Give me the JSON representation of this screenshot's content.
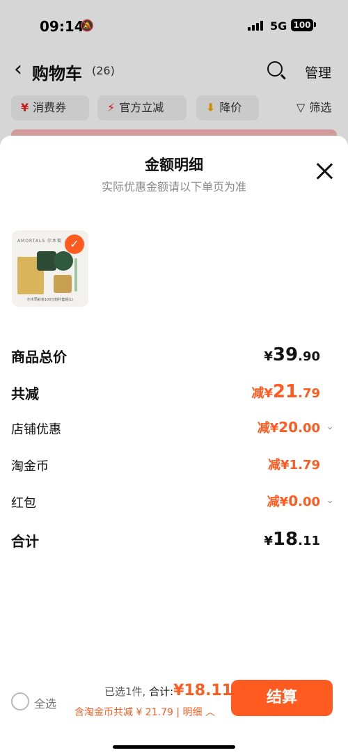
{
  "status_bar": {
    "time": "09:14",
    "network": "5G",
    "battery": "100"
  },
  "header": {
    "title": "购物车",
    "count": "(26)",
    "manage_label": "管理"
  },
  "filters": [
    {
      "icon": "¥",
      "label": "消费券"
    },
    {
      "icon": "⚡",
      "label": "官方立减"
    },
    {
      "icon": "⬇",
      "label": "降价"
    },
    {
      "icon": "▽",
      "label": "筛选"
    }
  ],
  "sheet": {
    "title": "金额明细",
    "subtitle": "实际优惠金额请以下单页为准",
    "product": {
      "brand": "AMORTALS 尔木萄",
      "caption": "尔木萄彩妆100分粉扑套组(L)"
    },
    "rows": [
      {
        "label": "商品总价",
        "prefix": "¥",
        "int": "39",
        "dec": ".90"
      },
      {
        "label": "共减",
        "prefix": "减¥",
        "int": "21",
        "dec": ".79"
      },
      {
        "label": "店铺优惠",
        "prefix": "减¥",
        "int": "20",
        "dec": ".00"
      },
      {
        "label": "淘金币",
        "prefix": "减¥",
        "int": "1",
        "dec": ".79"
      },
      {
        "label": "红包",
        "prefix": "减¥",
        "int": "0",
        "dec": ".00"
      },
      {
        "label": "合计",
        "prefix": "¥",
        "int": "18",
        "dec": ".11"
      }
    ]
  },
  "bottom_bar": {
    "select_all": "全选",
    "selected": "已选1件,",
    "total_label": "合计:",
    "total": "¥18.11",
    "discount": "含淘金币共减 ¥ 21.79 | 明细",
    "settle_label": "结算"
  },
  "colors": {
    "accent": "#ff5a1f"
  }
}
